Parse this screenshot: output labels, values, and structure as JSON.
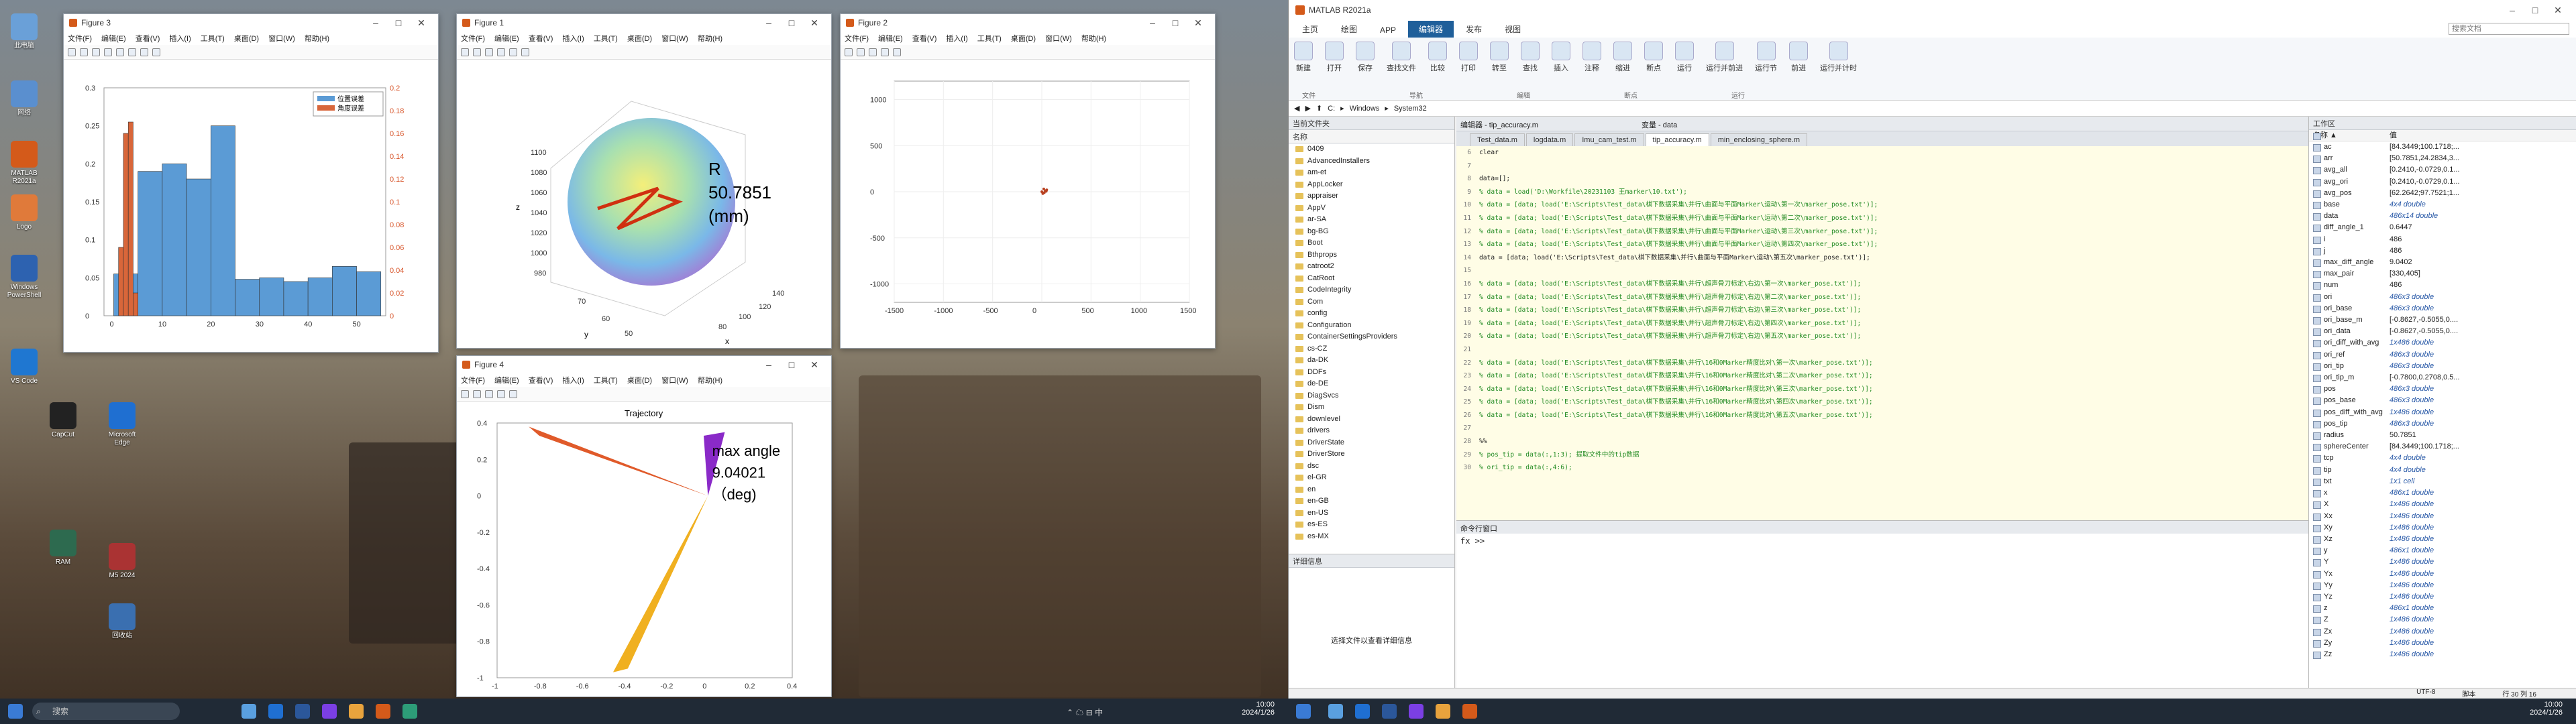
{
  "desktop": {
    "icons": [
      {
        "label": "此电脑"
      },
      {
        "label": "网络"
      },
      {
        "label": "MATLAB R2021a"
      },
      {
        "label": "Logo"
      },
      {
        "label": "Windows PowerShell"
      },
      {
        "label": "VS Code"
      },
      {
        "label": "CapCut"
      },
      {
        "label": "Microsoft Edge"
      },
      {
        "label": "RAM"
      },
      {
        "label": "M5 2024"
      },
      {
        "label": "回收站"
      }
    ]
  },
  "figure3": {
    "title": "Figure 3",
    "menu": [
      "文件(F)",
      "编辑(E)",
      "查看(V)",
      "插入(I)",
      "工具(T)",
      "桌面(D)",
      "窗口(W)",
      "帮助(H)"
    ],
    "legend": [
      "位置误差",
      "角度误差"
    ]
  },
  "figure1": {
    "title": "Figure 1",
    "menu": [
      "文件(F)",
      "编辑(E)",
      "查看(V)",
      "插入(I)",
      "工具(T)",
      "桌面(D)",
      "窗口(W)",
      "帮助(H)"
    ],
    "annotation_line1": "R",
    "annotation_line2": "50.7851",
    "annotation_line3": "(mm)",
    "zlabel": "z",
    "ylabel": "y",
    "xlabel": "x"
  },
  "figure2": {
    "title": "Figure 2",
    "menu": [
      "文件(F)",
      "编辑(E)",
      "查看(V)",
      "插入(I)",
      "工具(T)",
      "桌面(D)",
      "窗口(W)",
      "帮助(H)"
    ]
  },
  "figure4": {
    "title": "Figure 4",
    "menu": [
      "文件(F)",
      "编辑(E)",
      "查看(V)",
      "插入(I)",
      "工具(T)",
      "桌面(D)",
      "窗口(W)",
      "帮助(H)"
    ],
    "plot_title": "Trajectory",
    "annotation_line1": "max angle",
    "annotation_line2": "9.04021",
    "annotation_line3": "（deg)"
  },
  "chart_data": [
    {
      "type": "bar",
      "title": "",
      "series": [
        {
          "name": "位置误差",
          "x": [
            0,
            5,
            10,
            15,
            20,
            25,
            30,
            35,
            40,
            45,
            50,
            55
          ],
          "values": [
            0.055,
            0.19,
            0.2,
            0.18,
            0.25,
            0.048,
            0.05,
            0.045,
            0.05,
            0.065,
            0.058,
            0.0
          ]
        },
        {
          "name": "角度误差",
          "x": [
            1,
            2,
            3,
            4
          ],
          "values": [
            0.06,
            0.16,
            0.17,
            0.02
          ]
        }
      ],
      "yticks_left": [
        "0",
        "0.05",
        "0.1",
        "0.15",
        "0.2",
        "0.25",
        "0.3"
      ],
      "yticks_right": [
        "0",
        "0.02",
        "0.04",
        "0.06",
        "0.08",
        "0.1",
        "0.12",
        "0.14",
        "0.16",
        "0.18",
        "0.2"
      ],
      "xticks": [
        "0",
        "10",
        "20",
        "30",
        "40",
        "50"
      ],
      "ylim": [
        0,
        0.3
      ]
    },
    {
      "type": "scatter",
      "title": "",
      "xticks": [
        "-1500",
        "-1000",
        "-500",
        "0",
        "500",
        "1000",
        "1500"
      ],
      "yticks": [
        "-1000",
        "-500",
        "0",
        "500",
        "1000"
      ],
      "xlim": [
        -1500,
        1500
      ],
      "ylim": [
        -1200,
        1200
      ]
    },
    {
      "type": "line",
      "title": "Trajectory",
      "xticks": [
        "-1",
        "-0.8",
        "-0.6",
        "-0.4",
        "-0.2",
        "0",
        "0.2",
        "0.4"
      ],
      "yticks": [
        "-1",
        "-0.8",
        "-0.6",
        "-0.4",
        "-0.2",
        "0",
        "0.2",
        "0.4"
      ],
      "xlim": [
        -1,
        0.4
      ],
      "ylim": [
        -1,
        0.4
      ]
    }
  ],
  "matlab": {
    "title": "MATLAB R2021a",
    "ribbon_tabs": [
      "主页",
      "绘图",
      "APP",
      "编辑器",
      "发布",
      "视图"
    ],
    "active_tab": "编辑器",
    "ribbon_groups": [
      {
        "label": "新建"
      },
      {
        "label": "打开"
      },
      {
        "label": "保存"
      },
      {
        "label": "查找文件"
      },
      {
        "label": "比较"
      },
      {
        "label": "打印"
      },
      {
        "label": "转至"
      },
      {
        "label": "查找"
      },
      {
        "label": "插入"
      },
      {
        "label": "注释"
      },
      {
        "label": "缩进"
      },
      {
        "label": "断点"
      },
      {
        "label": "运行"
      },
      {
        "label": "运行并前进"
      },
      {
        "label": "运行节"
      },
      {
        "label": "前进"
      },
      {
        "label": "运行并计时"
      }
    ],
    "ribbon_sections": [
      "文件",
      "导航",
      "编辑",
      "断点",
      "运行"
    ],
    "search_placeholder": "搜索文档",
    "address": [
      "C:",
      "Windows",
      "System32"
    ],
    "current_folder_header": "当前文件夹",
    "file_list_header": "名称",
    "files": [
      "0409",
      "AdvancedInstallers",
      "am-et",
      "AppLocker",
      "appraiser",
      "AppV",
      "ar-SA",
      "bg-BG",
      "Boot",
      "Bthprops",
      "catroot2",
      "CatRoot",
      "CodeIntegrity",
      "Com",
      "config",
      "Configuration",
      "ContainerSettingsProviders",
      "cs-CZ",
      "da-DK",
      "DDFs",
      "de-DE",
      "DiagSvcs",
      "Dism",
      "downlevel",
      "drivers",
      "DriverState",
      "DriverStore",
      "dsc",
      "el-GR",
      "en",
      "en-GB",
      "en-US",
      "es-ES",
      "es-MX"
    ],
    "details_header": "详细信息",
    "details_text": "选择文件以查看详细信息",
    "editor_header": "编辑器 - tip_accuracy.m",
    "variables_header": "变量 - data",
    "editor_tabs": [
      "Test_data.m",
      "logdata.m",
      "Imu_cam_test.m",
      "tip_accuracy.m",
      "min_enclosing_sphere.m"
    ],
    "active_editor_tab": "tip_accuracy.m",
    "code_lines": [
      {
        "n": "6",
        "t": "clear",
        "c": false
      },
      {
        "n": "7",
        "t": "",
        "c": false
      },
      {
        "n": "8",
        "t": "data=[];",
        "c": false
      },
      {
        "n": "9",
        "t": "% data = load('D:\\Workfile\\20231103 王marker\\10.txt');",
        "c": true
      },
      {
        "n": "10",
        "t": "% data = [data; load('E:\\Scripts\\Test_data\\棋下数据采集\\并行\\曲面与平面Marker\\运动\\第一次\\marker_pose.txt')];",
        "c": true
      },
      {
        "n": "11",
        "t": "% data = [data; load('E:\\Scripts\\Test_data\\棋下数据采集\\并行\\曲面与平面Marker\\运动\\第二次\\marker_pose.txt')];",
        "c": true
      },
      {
        "n": "12",
        "t": "% data = [data; load('E:\\Scripts\\Test_data\\棋下数据采集\\并行\\曲面与平面Marker\\运动\\第三次\\marker_pose.txt')];",
        "c": true
      },
      {
        "n": "13",
        "t": "% data = [data; load('E:\\Scripts\\Test_data\\棋下数据采集\\并行\\曲面与平面Marker\\运动\\第四次\\marker_pose.txt')];",
        "c": true
      },
      {
        "n": "14",
        "t": "data = [data; load('E:\\Scripts\\Test_data\\棋下数据采集\\并行\\曲面与平面Marker\\运动\\第五次\\marker_pose.txt')];",
        "c": false
      },
      {
        "n": "15",
        "t": "",
        "c": false
      },
      {
        "n": "16",
        "t": "% data = [data; load('E:\\Scripts\\Test_data\\棋下数据采集\\并行\\超声骨刀标定\\右边\\第一次\\marker_pose.txt')];",
        "c": true
      },
      {
        "n": "17",
        "t": "% data = [data; load('E:\\Scripts\\Test_data\\棋下数据采集\\并行\\超声骨刀标定\\右边\\第二次\\marker_pose.txt')];",
        "c": true
      },
      {
        "n": "18",
        "t": "% data = [data; load('E:\\Scripts\\Test_data\\棋下数据采集\\并行\\超声骨刀标定\\右边\\第三次\\marker_pose.txt')];",
        "c": true
      },
      {
        "n": "19",
        "t": "% data = [data; load('E:\\Scripts\\Test_data\\棋下数据采集\\并行\\超声骨刀标定\\右边\\第四次\\marker_pose.txt')];",
        "c": true
      },
      {
        "n": "20",
        "t": "% data = [data; load('E:\\Scripts\\Test_data\\棋下数据采集\\并行\\超声骨刀标定\\右边\\第五次\\marker_pose.txt')];",
        "c": true
      },
      {
        "n": "21",
        "t": "",
        "c": false
      },
      {
        "n": "22",
        "t": "% data = [data; load('E:\\Scripts\\Test_data\\棋下数据采集\\并行\\16和0Marker精度比对\\第一次\\marker_pose.txt')];",
        "c": true
      },
      {
        "n": "23",
        "t": "% data = [data; load('E:\\Scripts\\Test_data\\棋下数据采集\\并行\\16和0Marker精度比对\\第二次\\marker_pose.txt')];",
        "c": true
      },
      {
        "n": "24",
        "t": "% data = [data; load('E:\\Scripts\\Test_data\\棋下数据采集\\并行\\16和0Marker精度比对\\第三次\\marker_pose.txt')];",
        "c": true
      },
      {
        "n": "25",
        "t": "% data = [data; load('E:\\Scripts\\Test_data\\棋下数据采集\\并行\\16和0Marker精度比对\\第四次\\marker_pose.txt')];",
        "c": true
      },
      {
        "n": "26",
        "t": "% data = [data; load('E:\\Scripts\\Test_data\\棋下数据采集\\并行\\16和0Marker精度比对\\第五次\\marker_pose.txt')];",
        "c": true
      },
      {
        "n": "27",
        "t": "",
        "c": false
      },
      {
        "n": "28",
        "t": "%%",
        "c": false
      },
      {
        "n": "29",
        "t": "% pos_tip = data(:,1:3);  提取文件中的tip数据",
        "c": true
      },
      {
        "n": "30",
        "t": "% ori_tip = data(:,4:6);",
        "c": true
      }
    ],
    "command_header": "命令行窗口",
    "command_prompt": "fx >>",
    "workspace_header": "工作区",
    "workspace_cols": [
      "名称 ▲",
      "值"
    ],
    "workspace": [
      {
        "n": "ac",
        "v": "[84.3449;100.1718;...",
        "it": false
      },
      {
        "n": "arr",
        "v": "[50.7851,24.2834,3...",
        "it": false
      },
      {
        "n": "avg_all",
        "v": "[0.2410,-0.0729,0.1...",
        "it": false
      },
      {
        "n": "avg_ori",
        "v": "[0.2410,-0.0729,0.1...",
        "it": false
      },
      {
        "n": "avg_pos",
        "v": "[62.2642;97.7521;1...",
        "it": false
      },
      {
        "n": "base",
        "v": "4x4 double",
        "it": true
      },
      {
        "n": "data",
        "v": "486x14 double",
        "it": true
      },
      {
        "n": "diff_angle_1",
        "v": "0.6447",
        "it": false
      },
      {
        "n": "i",
        "v": "486",
        "it": false
      },
      {
        "n": "j",
        "v": "486",
        "it": false
      },
      {
        "n": "max_diff_angle",
        "v": "9.0402",
        "it": false
      },
      {
        "n": "max_pair",
        "v": "[330,405]",
        "it": false
      },
      {
        "n": "num",
        "v": "486",
        "it": false
      },
      {
        "n": "ori",
        "v": "486x3 double",
        "it": true
      },
      {
        "n": "ori_base",
        "v": "486x3 double",
        "it": true
      },
      {
        "n": "ori_base_m",
        "v": "[-0.8627,-0.5055,0....",
        "it": false
      },
      {
        "n": "ori_data",
        "v": "[-0.8627,-0.5055,0....",
        "it": false
      },
      {
        "n": "ori_diff_with_avg",
        "v": "1x486 double",
        "it": true
      },
      {
        "n": "ori_ref",
        "v": "486x3 double",
        "it": true
      },
      {
        "n": "ori_tip",
        "v": "486x3 double",
        "it": true
      },
      {
        "n": "ori_tip_m",
        "v": "[-0.7800,0.2708,0.5...",
        "it": false
      },
      {
        "n": "pos",
        "v": "486x3 double",
        "it": true
      },
      {
        "n": "pos_base",
        "v": "486x3 double",
        "it": true
      },
      {
        "n": "pos_diff_with_avg",
        "v": "1x486 double",
        "it": true
      },
      {
        "n": "pos_tip",
        "v": "486x3 double",
        "it": true
      },
      {
        "n": "radius",
        "v": "50.7851",
        "it": false
      },
      {
        "n": "sphereCenter",
        "v": "[84.3449;100.1718;...",
        "it": false
      },
      {
        "n": "tcp",
        "v": "4x4 double",
        "it": true
      },
      {
        "n": "tip",
        "v": "4x4 double",
        "it": true
      },
      {
        "n": "txt",
        "v": "1x1 cell",
        "it": true
      },
      {
        "n": "x",
        "v": "486x1 double",
        "it": true
      },
      {
        "n": "X",
        "v": "1x486 double",
        "it": true
      },
      {
        "n": "Xx",
        "v": "1x486 double",
        "it": true
      },
      {
        "n": "Xy",
        "v": "1x486 double",
        "it": true
      },
      {
        "n": "Xz",
        "v": "1x486 double",
        "it": true
      },
      {
        "n": "y",
        "v": "486x1 double",
        "it": true
      },
      {
        "n": "Y",
        "v": "1x486 double",
        "it": true
      },
      {
        "n": "Yx",
        "v": "1x486 double",
        "it": true
      },
      {
        "n": "Yy",
        "v": "1x486 double",
        "it": true
      },
      {
        "n": "Yz",
        "v": "1x486 double",
        "it": true
      },
      {
        "n": "z",
        "v": "486x1 double",
        "it": true
      },
      {
        "n": "Z",
        "v": "1x486 double",
        "it": true
      },
      {
        "n": "Zx",
        "v": "1x486 double",
        "it": true
      },
      {
        "n": "Zy",
        "v": "1x486 double",
        "it": true
      },
      {
        "n": "Zz",
        "v": "1x486 double",
        "it": true
      }
    ],
    "status_encoding": "UTF-8",
    "status_script": "脚本",
    "status_position": "行 30  列 16"
  },
  "taskbar": {
    "search_label": "搜索",
    "time_left": "10:00",
    "date_left": "2024/1/26",
    "time_right": "10:00",
    "date_right": "2024/1/26",
    "ime": "中",
    "status_glyphs": "⌃ ☁ ⊟ 中"
  }
}
